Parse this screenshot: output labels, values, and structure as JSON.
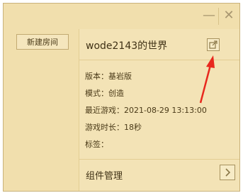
{
  "window": {
    "minimize_glyph": "—",
    "close_glyph": "✕"
  },
  "left": {
    "new_room_label": "新建房间"
  },
  "world": {
    "title": "wode2143的世界",
    "version": "版本：基岩版",
    "mode": "模式：创造",
    "last_played": "最近游戏：2021-08-29 13:13:00",
    "play_time": "游戏时长：18秒",
    "tags": "标签："
  },
  "components": {
    "label": "组件管理"
  },
  "colors": {
    "background": "#f1dfad",
    "annotation_arrow": "#e8281e"
  },
  "icons": {
    "open_icon": "external-link-icon",
    "chevron": "chevron-right-icon"
  }
}
